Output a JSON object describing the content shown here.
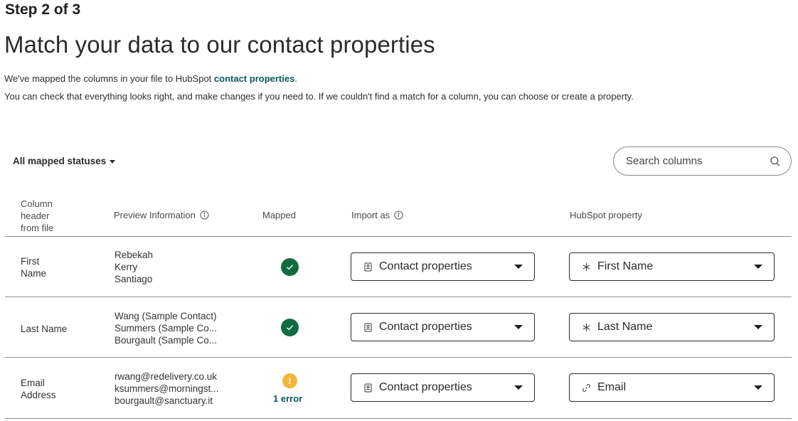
{
  "header": {
    "step": "Step 2 of 3",
    "title": "Match your data to our contact properties",
    "intro_prefix": "We've mapped the columns in your file to HubSpot ",
    "intro_link": "contact properties",
    "intro_suffix": ".",
    "intro_line2": "You can check that everything looks right, and make changes if you need to. If we couldn't find a match for a column, you can choose or create a property."
  },
  "toolbar": {
    "filter_label": "All mapped statuses",
    "search_placeholder": "Search columns"
  },
  "table": {
    "columns": {
      "column_header_line1": "Column",
      "column_header_line2": "header",
      "column_header_line3": "from file",
      "preview": "Preview Information",
      "mapped": "Mapped",
      "import_as": "Import as",
      "hubspot_property": "HubSpot property"
    },
    "rows": [
      {
        "name_line1": "First",
        "name_line2": "Name",
        "preview": [
          "Rebekah",
          "Kerry",
          "Santiago"
        ],
        "status": "ok",
        "import_as": "Contact properties",
        "property": "First Name",
        "property_icon": "asterisk-icon"
      },
      {
        "name_line1": "Last Name",
        "name_line2": "",
        "preview": [
          "Wang (Sample Contact)",
          "Summers (Sample Co...",
          "Bourgault (Sample Co..."
        ],
        "status": "ok",
        "import_as": "Contact properties",
        "property": "Last Name",
        "property_icon": "asterisk-icon"
      },
      {
        "name_line1": "Email",
        "name_line2": "Address",
        "preview": [
          "rwang@redelivery.co.uk",
          "ksummers@morningst...",
          "bourgault@sanctuary.it"
        ],
        "status": "warn",
        "status_symbol": "!",
        "error_label": "1 error",
        "import_as": "Contact properties",
        "property": "Email",
        "property_icon": "link-icon"
      }
    ]
  },
  "colors": {
    "link": "#0b5a5a",
    "ok_status": "#0f6b3f",
    "warn_status": "#f2b63a"
  }
}
